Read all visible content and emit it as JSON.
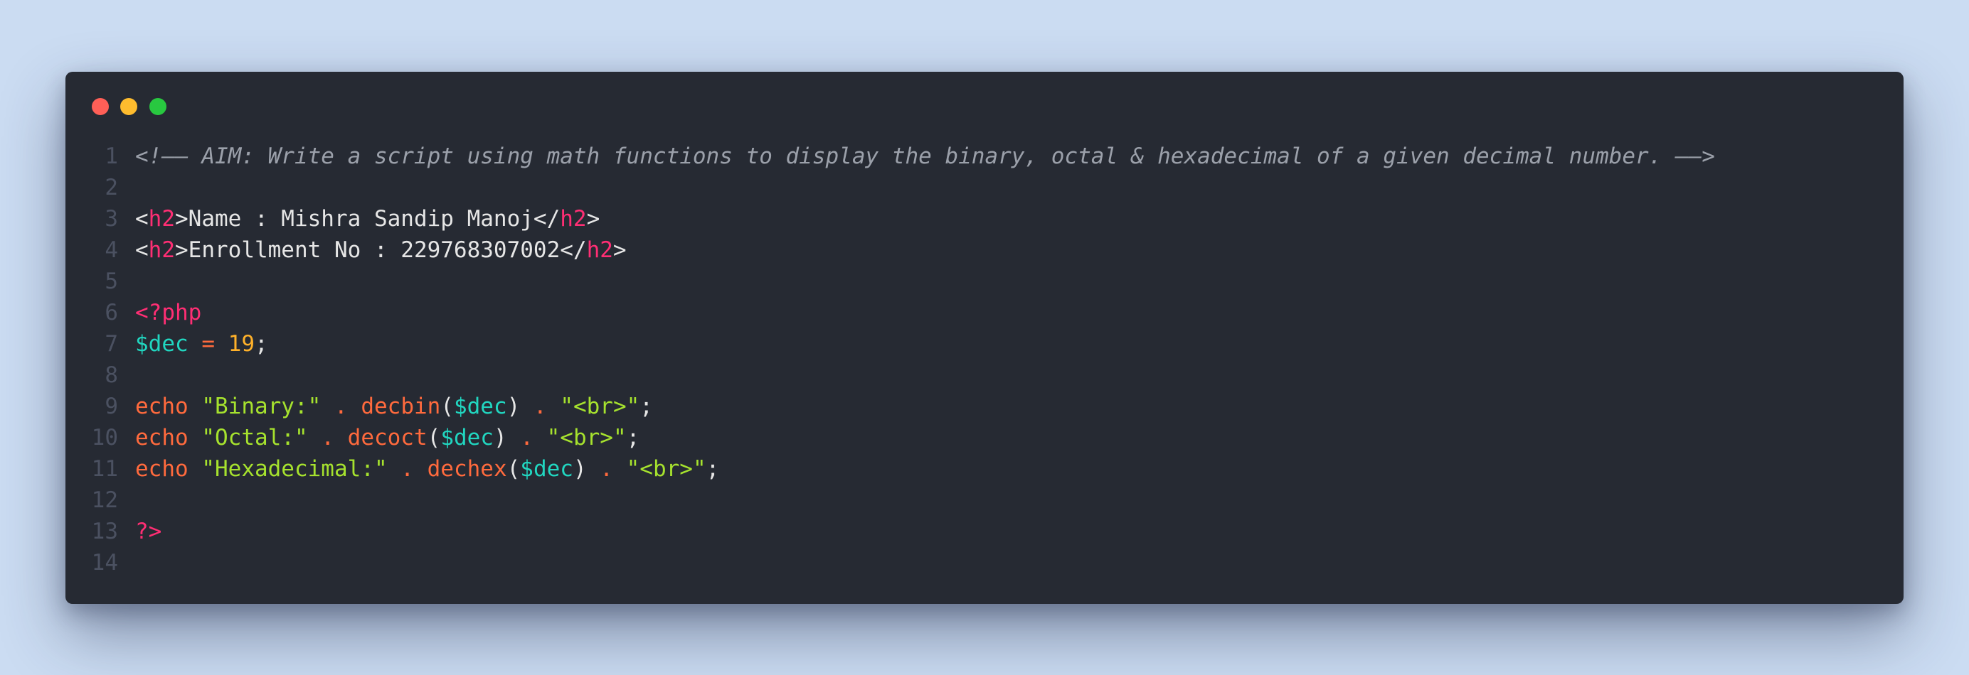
{
  "window": {
    "traffic_lights": [
      "close",
      "minimize",
      "maximize"
    ]
  },
  "colors": {
    "background": "#cbdcf2",
    "editor": "#262a33",
    "line_number": "#4b5161",
    "comment": "#9ba0aa",
    "tag": "#ff2e74",
    "variable": "#21d6c0",
    "keyword": "#ff6a3d",
    "string": "#a6e22e",
    "number": "#ffb12a"
  },
  "code": {
    "lines": [
      {
        "n": "1",
        "tokens": [
          {
            "t": "comment",
            "v": "<!—— AIM: Write a script using math functions to display the binary, octal & hexadecimal of a given decimal number. ——>"
          }
        ]
      },
      {
        "n": "2",
        "tokens": []
      },
      {
        "n": "3",
        "tokens": [
          {
            "t": "plain",
            "v": "<"
          },
          {
            "t": "tag",
            "v": "h2"
          },
          {
            "t": "plain",
            "v": ">Name : Mishra Sandip Manoj</"
          },
          {
            "t": "tag",
            "v": "h2"
          },
          {
            "t": "plain",
            "v": ">"
          }
        ]
      },
      {
        "n": "4",
        "tokens": [
          {
            "t": "plain",
            "v": "<"
          },
          {
            "t": "tag",
            "v": "h2"
          },
          {
            "t": "plain",
            "v": ">Enrollment No : 229768307002</"
          },
          {
            "t": "tag",
            "v": "h2"
          },
          {
            "t": "plain",
            "v": ">"
          }
        ]
      },
      {
        "n": "5",
        "tokens": []
      },
      {
        "n": "6",
        "tokens": [
          {
            "t": "php",
            "v": "<?php"
          }
        ]
      },
      {
        "n": "7",
        "tokens": [
          {
            "t": "var",
            "v": "$dec"
          },
          {
            "t": "plain",
            "v": " "
          },
          {
            "t": "op",
            "v": "="
          },
          {
            "t": "plain",
            "v": " "
          },
          {
            "t": "num",
            "v": "19"
          },
          {
            "t": "plain",
            "v": ";"
          }
        ]
      },
      {
        "n": "8",
        "tokens": []
      },
      {
        "n": "9",
        "tokens": [
          {
            "t": "kw",
            "v": "echo"
          },
          {
            "t": "plain",
            "v": " "
          },
          {
            "t": "str",
            "v": "\"Binary:\""
          },
          {
            "t": "plain",
            "v": " "
          },
          {
            "t": "op",
            "v": "."
          },
          {
            "t": "plain",
            "v": " "
          },
          {
            "t": "fn",
            "v": "decbin"
          },
          {
            "t": "plain",
            "v": "("
          },
          {
            "t": "var",
            "v": "$dec"
          },
          {
            "t": "plain",
            "v": ") "
          },
          {
            "t": "op",
            "v": "."
          },
          {
            "t": "plain",
            "v": " "
          },
          {
            "t": "str",
            "v": "\"<br>\""
          },
          {
            "t": "plain",
            "v": ";"
          }
        ]
      },
      {
        "n": "10",
        "tokens": [
          {
            "t": "kw",
            "v": "echo"
          },
          {
            "t": "plain",
            "v": " "
          },
          {
            "t": "str",
            "v": "\"Octal:\""
          },
          {
            "t": "plain",
            "v": " "
          },
          {
            "t": "op",
            "v": "."
          },
          {
            "t": "plain",
            "v": " "
          },
          {
            "t": "fn",
            "v": "decoct"
          },
          {
            "t": "plain",
            "v": "("
          },
          {
            "t": "var",
            "v": "$dec"
          },
          {
            "t": "plain",
            "v": ") "
          },
          {
            "t": "op",
            "v": "."
          },
          {
            "t": "plain",
            "v": " "
          },
          {
            "t": "str",
            "v": "\"<br>\""
          },
          {
            "t": "plain",
            "v": ";"
          }
        ]
      },
      {
        "n": "11",
        "tokens": [
          {
            "t": "kw",
            "v": "echo"
          },
          {
            "t": "plain",
            "v": " "
          },
          {
            "t": "str",
            "v": "\"Hexadecimal:\""
          },
          {
            "t": "plain",
            "v": " "
          },
          {
            "t": "op",
            "v": "."
          },
          {
            "t": "plain",
            "v": " "
          },
          {
            "t": "fn",
            "v": "dechex"
          },
          {
            "t": "plain",
            "v": "("
          },
          {
            "t": "var",
            "v": "$dec"
          },
          {
            "t": "plain",
            "v": ") "
          },
          {
            "t": "op",
            "v": "."
          },
          {
            "t": "plain",
            "v": " "
          },
          {
            "t": "str",
            "v": "\"<br>\""
          },
          {
            "t": "plain",
            "v": ";"
          }
        ]
      },
      {
        "n": "12",
        "tokens": []
      },
      {
        "n": "13",
        "tokens": [
          {
            "t": "php",
            "v": "?>"
          }
        ]
      },
      {
        "n": "14",
        "tokens": []
      }
    ]
  }
}
